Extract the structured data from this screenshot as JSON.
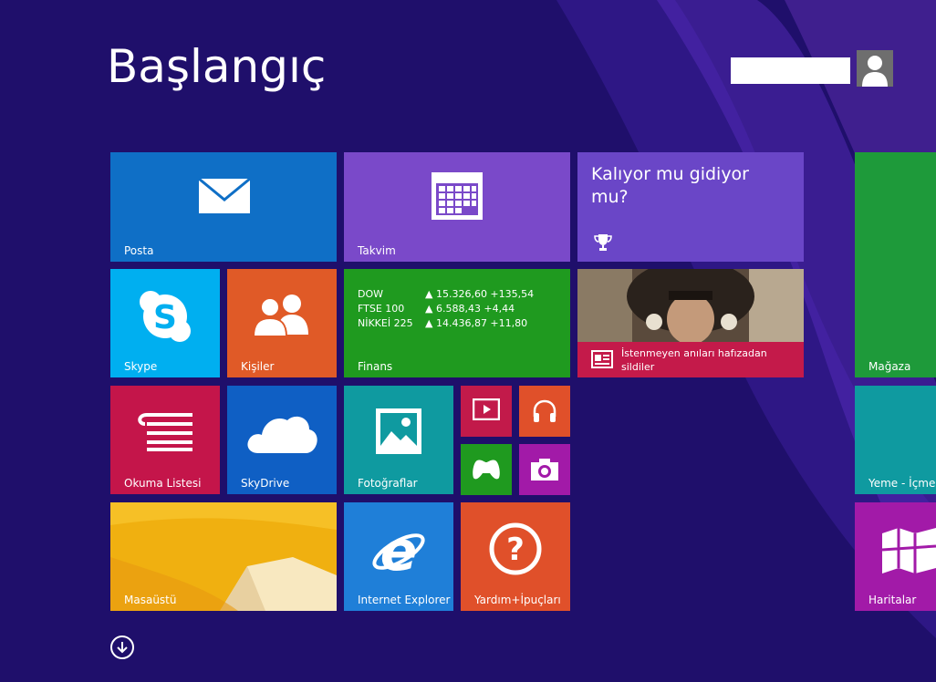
{
  "screen": {
    "title": "Başlangıç",
    "user_name": "",
    "background_color": "#1f0f6b",
    "accent_swirl_color": "#7a3fd0"
  },
  "tiles": {
    "mail": {
      "label": "Posta",
      "icon": "mail-icon",
      "color": "#0f6fc6"
    },
    "calendar": {
      "label": "Takvim",
      "icon": "calendar-icon",
      "color": "#7a49c9"
    },
    "sports": {
      "text": "Kalıyor mu gidiyor mu?",
      "icon": "trophy-icon",
      "color": "#6a46c7"
    },
    "store": {
      "label": "Mağaza",
      "icon": "store-icon",
      "color": "#1e9a3a"
    },
    "skype": {
      "label": "Skype",
      "icon": "skype-icon",
      "color": "#00aff0"
    },
    "people": {
      "label": "Kişiler",
      "icon": "people-icon",
      "color": "#e05a27"
    },
    "finance": {
      "label": "Finans",
      "color": "#1f9a1f",
      "rows": [
        {
          "name": "DOW",
          "value": "▲ 15.326,60 +135,54"
        },
        {
          "name": "FTSE 100",
          "value": "▲ 6.588,43 +4,44"
        },
        {
          "name": "NİKKEİ 225",
          "value": "▲ 14.436,87 +11,80"
        }
      ]
    },
    "news": {
      "headline": "İstenmeyen anıları hafızadan sildiler",
      "icon": "news-icon",
      "color": "#c41a4a"
    },
    "reading_list": {
      "label": "Okuma Listesi",
      "icon": "reading-list-icon",
      "color": "#c4154a"
    },
    "skydrive": {
      "label": "SkyDrive",
      "icon": "cloud-icon",
      "color": "#0f5fc4"
    },
    "photos": {
      "label": "Fotoğraflar",
      "icon": "photos-icon",
      "color": "#0f9aa0"
    },
    "video": {
      "icon": "video-icon",
      "color": "#c21a4a"
    },
    "music": {
      "icon": "headphones-icon",
      "color": "#e0502a"
    },
    "games": {
      "icon": "gamepad-icon",
      "color": "#1f9a1f"
    },
    "camera": {
      "icon": "camera-icon",
      "color": "#a21aa8"
    },
    "food": {
      "label": "Yeme - İçme",
      "icon": "food-icon",
      "color": "#0f9aa0"
    },
    "desktop": {
      "label": "Masaüstü",
      "color": "#f0b010"
    },
    "ie": {
      "label": "Internet Explorer",
      "icon": "ie-icon",
      "color": "#1f7fd8"
    },
    "help": {
      "label": "Yardım+İpuçları",
      "icon": "help-icon",
      "color": "#e0502a"
    },
    "maps": {
      "label": "Haritalar",
      "icon": "maps-icon",
      "color": "#a21aa8"
    }
  },
  "bottom": {
    "apps_button_icon": "arrow-down-circle-icon"
  }
}
